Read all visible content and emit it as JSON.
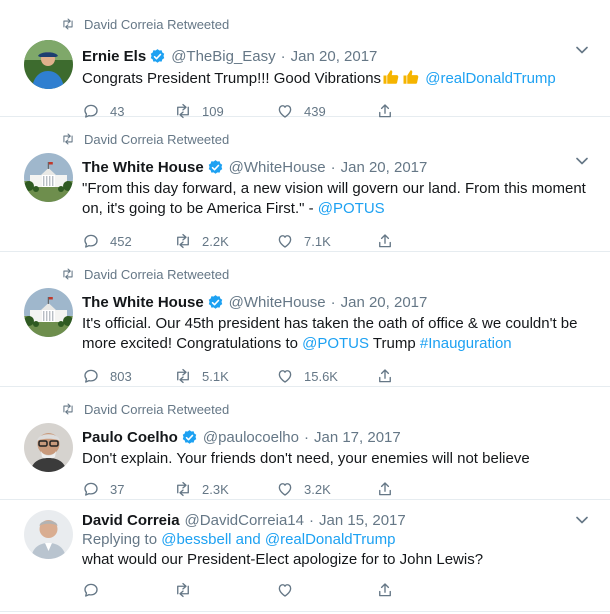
{
  "tweets": [
    {
      "retweeted_by": "David Correia Retweeted",
      "name": "Ernie Els",
      "verified": true,
      "handle": "@TheBig_Easy",
      "date": "Jan 20, 2017",
      "text_before": "Congrats President Trump!!! Good Vibrations",
      "emoji": "thumbs-up-icon",
      "mention": "@realDonaldTrump",
      "replies": "43",
      "retweets": "109",
      "likes": "439"
    },
    {
      "retweeted_by": "David Correia Retweeted",
      "name": "The White House",
      "verified": true,
      "handle": "@WhiteHouse",
      "date": "Jan 20, 2017",
      "text_line1": "\"From this day forward, a new vision will govern our land. From this moment",
      "text_line2": "on, it's going to be America First.\" - ",
      "mention": "@POTUS",
      "replies": "452",
      "retweets": "2.2K",
      "likes": "7.1K"
    },
    {
      "retweeted_by": "David Correia Retweeted",
      "name": "The White House",
      "verified": true,
      "handle": "@WhiteHouse",
      "date": "Jan 20, 2017",
      "text_line1": "It's official. Our 45th president has taken the oath of office & we couldn't be",
      "text_line2_a": "more excited! Congratulations to ",
      "mention": "@POTUS",
      "text_line2_b": " Trump ",
      "hashtag": "#Inauguration",
      "replies": "803",
      "retweets": "5.1K",
      "likes": "15.6K"
    },
    {
      "retweeted_by": "David Correia Retweeted",
      "name": "Paulo Coelho",
      "verified": true,
      "handle": "@paulocoelho",
      "date": "Jan 17, 2017",
      "text": "Don't explain. Your friends don't need, your enemies will not believe",
      "replies": "37",
      "retweets": "2.3K",
      "likes": "3.2K"
    },
    {
      "name": "David Correia",
      "verified": false,
      "handle": "@DavidCorreia14",
      "date": "Jan 15, 2017",
      "replying_to_label": "Replying to",
      "replying_mention1": "@bessbell",
      "replying_and": " and ",
      "replying_mention2": "@realDonaldTrump",
      "text": "what would our President-Elect apologize for to John Lewis?"
    }
  ],
  "separator": "·",
  "colors": {
    "accent": "#1da1f2",
    "muted": "#657786",
    "text": "#14171a",
    "border": "#e6ecf0"
  }
}
